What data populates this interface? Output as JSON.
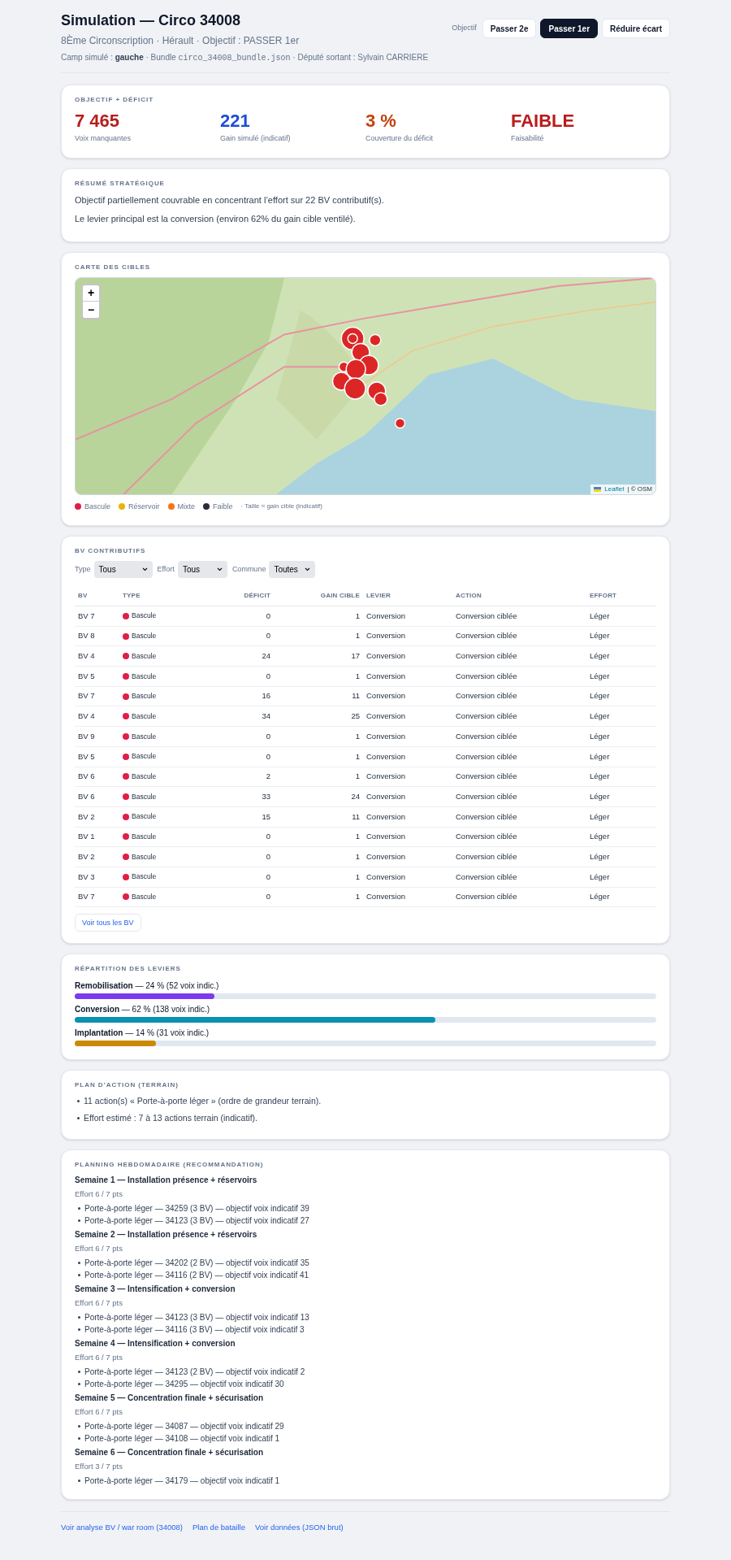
{
  "header": {
    "title": "Simulation — Circo 34008",
    "subtitle": "8Ème Circonscription · Hérault · Objectif : PASSER 1er",
    "meta": [
      {
        "kind": "plain",
        "text": "Camp simulé : "
      },
      {
        "kind": "bold",
        "text": "gauche"
      },
      {
        "kind": "plain",
        "text": " · Bundle "
      },
      {
        "kind": "code",
        "text": "circo_34008_bundle.json"
      },
      {
        "kind": "plain",
        "text": " · Député sortant : Sylvain CARRIERE"
      }
    ],
    "objective_label": "Objectif",
    "objective_buttons": [
      {
        "label": "Passer 2e",
        "selected": false
      },
      {
        "label": "Passer 1er",
        "selected": true
      },
      {
        "label": "Réduire écart",
        "selected": false
      }
    ]
  },
  "deficit": {
    "title": "OBJECTIF + DÉFICIT",
    "kpis": [
      {
        "value": "7 465",
        "label": "Voix manquantes",
        "color": "#b91c1c"
      },
      {
        "value": "221",
        "label": "Gain simulé (indicatif)",
        "color": "#1d4ed8"
      },
      {
        "value": "3 %",
        "label": "Couverture du déficit",
        "color": "#c2410c"
      },
      {
        "value": "FAIBLE",
        "label": "Faisabilité",
        "color": "#b91c1c"
      }
    ]
  },
  "summary": {
    "title": "RÉSUMÉ STRATÉGIQUE",
    "lines": [
      "Objectif partiellement couvrable en concentrant l’effort sur 22 BV contributif(s).",
      "Le levier principal est la conversion (environ 62% du gain cible ventilé)."
    ]
  },
  "map": {
    "title": "CARTE DES CIBLES",
    "zoom_in": "+",
    "zoom_out": "−",
    "attribution_link": "Leaflet",
    "attribution_text": "| © OSM",
    "legend": [
      {
        "label": "Bascule",
        "color": "#e11d48"
      },
      {
        "label": "Réservoir",
        "color": "#eab308"
      },
      {
        "label": "Mixte",
        "color": "#f97316"
      },
      {
        "label": "Faible",
        "color": "#2e2a3b"
      }
    ],
    "legend_note": "· Taille ≈ gain cible (indicatif)"
  },
  "bv": {
    "title": "BV CONTRIBUTIFS",
    "filters": [
      {
        "label": "Type",
        "value": "Tous"
      },
      {
        "label": "Effort",
        "value": "Tous"
      },
      {
        "label": "Commune",
        "value": "Toutes"
      }
    ],
    "columns": [
      "BV",
      "TYPE",
      "DÉFICIT",
      "GAIN CIBLE",
      "LEVIER",
      "ACTION",
      "EFFORT"
    ],
    "rows": [
      {
        "bv": "BV 7",
        "type": "Bascule",
        "color": "#e11d48",
        "deficit": "0",
        "gain": "1",
        "levier": "Conversion",
        "action": "Conversion ciblée",
        "effort": "Léger"
      },
      {
        "bv": "BV 8",
        "type": "Bascule",
        "color": "#e11d48",
        "deficit": "0",
        "gain": "1",
        "levier": "Conversion",
        "action": "Conversion ciblée",
        "effort": "Léger"
      },
      {
        "bv": "BV 4",
        "type": "Bascule",
        "color": "#e11d48",
        "deficit": "24",
        "gain": "17",
        "levier": "Conversion",
        "action": "Conversion ciblée",
        "effort": "Léger"
      },
      {
        "bv": "BV 5",
        "type": "Bascule",
        "color": "#e11d48",
        "deficit": "0",
        "gain": "1",
        "levier": "Conversion",
        "action": "Conversion ciblée",
        "effort": "Léger"
      },
      {
        "bv": "BV 7",
        "type": "Bascule",
        "color": "#e11d48",
        "deficit": "16",
        "gain": "11",
        "levier": "Conversion",
        "action": "Conversion ciblée",
        "effort": "Léger"
      },
      {
        "bv": "BV 4",
        "type": "Bascule",
        "color": "#e11d48",
        "deficit": "34",
        "gain": "25",
        "levier": "Conversion",
        "action": "Conversion ciblée",
        "effort": "Léger"
      },
      {
        "bv": "BV 9",
        "type": "Bascule",
        "color": "#e11d48",
        "deficit": "0",
        "gain": "1",
        "levier": "Conversion",
        "action": "Conversion ciblée",
        "effort": "Léger"
      },
      {
        "bv": "BV 5",
        "type": "Bascule",
        "color": "#e11d48",
        "deficit": "0",
        "gain": "1",
        "levier": "Conversion",
        "action": "Conversion ciblée",
        "effort": "Léger"
      },
      {
        "bv": "BV 6",
        "type": "Bascule",
        "color": "#e11d48",
        "deficit": "2",
        "gain": "1",
        "levier": "Conversion",
        "action": "Conversion ciblée",
        "effort": "Léger"
      },
      {
        "bv": "BV 6",
        "type": "Bascule",
        "color": "#e11d48",
        "deficit": "33",
        "gain": "24",
        "levier": "Conversion",
        "action": "Conversion ciblée",
        "effort": "Léger"
      },
      {
        "bv": "BV 2",
        "type": "Bascule",
        "color": "#e11d48",
        "deficit": "15",
        "gain": "11",
        "levier": "Conversion",
        "action": "Conversion ciblée",
        "effort": "Léger"
      },
      {
        "bv": "BV 1",
        "type": "Bascule",
        "color": "#e11d48",
        "deficit": "0",
        "gain": "1",
        "levier": "Conversion",
        "action": "Conversion ciblée",
        "effort": "Léger"
      },
      {
        "bv": "BV 2",
        "type": "Bascule",
        "color": "#e11d48",
        "deficit": "0",
        "gain": "1",
        "levier": "Conversion",
        "action": "Conversion ciblée",
        "effort": "Léger"
      },
      {
        "bv": "BV 3",
        "type": "Bascule",
        "color": "#e11d48",
        "deficit": "0",
        "gain": "1",
        "levier": "Conversion",
        "action": "Conversion ciblée",
        "effort": "Léger"
      },
      {
        "bv": "BV 7",
        "type": "Bascule",
        "color": "#e11d48",
        "deficit": "0",
        "gain": "1",
        "levier": "Conversion",
        "action": "Conversion ciblée",
        "effort": "Léger"
      }
    ],
    "show_all": "Voir tous les BV"
  },
  "levers": {
    "title": "RÉPARTITION DES LEVIERS",
    "items": [
      {
        "label": "**Remobilisation** — 24 % (52 voix indic.)",
        "level": 0.24,
        "color": "#7c3aed"
      },
      {
        "label": "**Conversion** — 62 % (138 voix indic.)",
        "level": 0.62,
        "color": "#0891b2"
      },
      {
        "label": "**Implantation** — 14 % (31 voix indic.)",
        "level": 0.14,
        "color": "#ca8a04"
      }
    ]
  },
  "plan": {
    "title": "PLAN D’ACTION (TERRAIN)",
    "items": [
      "11 action(s) « Porte-à-porte léger » (ordre de grandeur terrain).",
      "Effort estimé : 7 à 13 actions terrain (indicatif)."
    ]
  },
  "planning": {
    "title": "PLANNING HEBDOMADAIRE (RECOMMANDATION)",
    "weeks": [
      {
        "title": "Semaine 1 — Installation présence + réservoirs",
        "effort": "Effort 6 / 7 pts",
        "items": [
          "Porte-à-porte léger — 34259 (3 BV) — objectif voix indicatif 39",
          "Porte-à-porte léger — 34123 (3 BV) — objectif voix indicatif 27"
        ]
      },
      {
        "title": "Semaine 2 — Installation présence + réservoirs",
        "effort": "Effort 6 / 7 pts",
        "items": [
          "Porte-à-porte léger — 34202 (2 BV) — objectif voix indicatif 35",
          "Porte-à-porte léger — 34116 (2 BV) — objectif voix indicatif 41"
        ]
      },
      {
        "title": "Semaine 3 — Intensification + conversion",
        "effort": "Effort 6 / 7 pts",
        "items": [
          "Porte-à-porte léger — 34123 (3 BV) — objectif voix indicatif 13",
          "Porte-à-porte léger — 34116 (3 BV) — objectif voix indicatif 3"
        ]
      },
      {
        "title": "Semaine 4 — Intensification + conversion",
        "effort": "Effort 6 / 7 pts",
        "items": [
          "Porte-à-porte léger — 34123 (2 BV) — objectif voix indicatif 2",
          "Porte-à-porte léger — 34295 — objectif voix indicatif 30"
        ]
      },
      {
        "title": "Semaine 5 — Concentration finale + sécurisation",
        "effort": "Effort 6 / 7 pts",
        "items": [
          "Porte-à-porte léger — 34087 — objectif voix indicatif 29",
          "Porte-à-porte léger — 34108 — objectif voix indicatif 1"
        ]
      },
      {
        "title": "Semaine 6 — Concentration finale + sécurisation",
        "effort": "Effort 3 / 7 pts",
        "items": [
          "Porte-à-porte léger — 34179 — objectif voix indicatif 1"
        ]
      }
    ]
  },
  "footer_links": [
    "Voir analyse BV / war room (34008)",
    "Plan de bataille",
    "Voir données (JSON brut)"
  ]
}
